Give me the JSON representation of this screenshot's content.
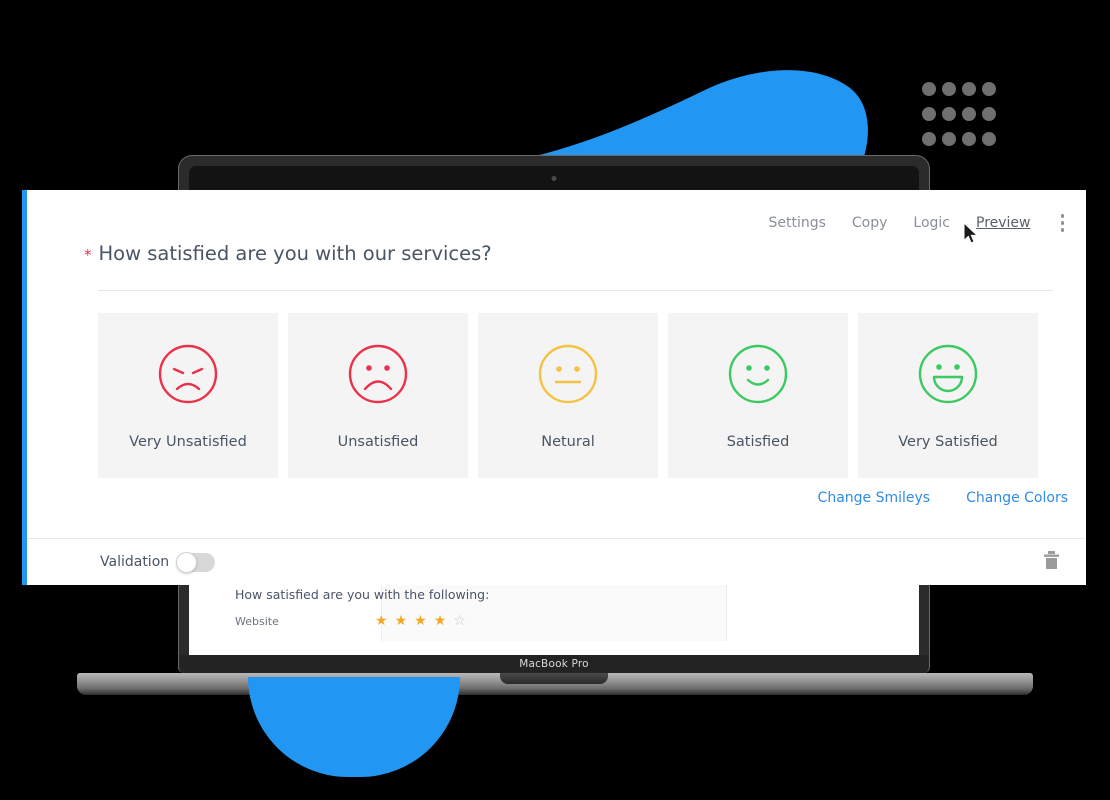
{
  "decor": {
    "background_color": "#000000",
    "accent_blue": "#2196f3",
    "dot_color": "#6f6f6f",
    "dot_count": 12
  },
  "laptop": {
    "brand_label": "MacBook Pro",
    "preview_question": "How satisfied are you with the following:",
    "preview_row_label": "Website",
    "preview_stars_filled": 4,
    "preview_stars_total": 5,
    "star_filled_color": "#f5a623",
    "star_empty_color": "#c9c9c9"
  },
  "card": {
    "accent_color": "#2196f3",
    "toolbar": {
      "items": [
        {
          "label": "Settings",
          "active": false
        },
        {
          "label": "Copy",
          "active": false
        },
        {
          "label": "Logic",
          "active": false
        },
        {
          "label": "Preview",
          "active": true
        }
      ],
      "kebab_icon": "more-vertical-icon"
    },
    "question": {
      "required_marker": "*",
      "required_marker_color": "#e8334a",
      "text": "How satisfied are you with our services?"
    },
    "options": [
      {
        "label": "Very Unsatisfied",
        "face": "very-sad",
        "color": "#e8334a"
      },
      {
        "label": "Unsatisfied",
        "face": "sad",
        "color": "#e8334a"
      },
      {
        "label": "Netural",
        "face": "neutral",
        "color": "#f5c342"
      },
      {
        "label": "Satisfied",
        "face": "happy",
        "color": "#3cc961"
      },
      {
        "label": "Very Satisfied",
        "face": "very-happy",
        "color": "#3cc961"
      }
    ],
    "links": [
      {
        "label": "Change Smileys"
      },
      {
        "label": "Change Colors"
      }
    ],
    "link_color": "#2f8ce8",
    "footer": {
      "validation_label": "Validation",
      "validation_enabled": false,
      "delete_icon": "trash-icon"
    }
  }
}
